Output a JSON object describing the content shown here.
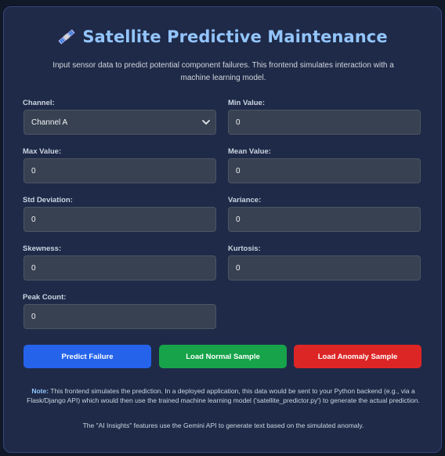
{
  "header": {
    "title": "Satellite Predictive Maintenance",
    "icon": "satellite-icon",
    "intro": "Input sensor data to predict potential component failures. This frontend simulates interaction with a machine learning model."
  },
  "form": {
    "channel": {
      "label": "Channel:",
      "value": "Channel A"
    },
    "min_value": {
      "label": "Min Value:",
      "value": "0"
    },
    "max_value": {
      "label": "Max Value:",
      "value": "0"
    },
    "mean_value": {
      "label": "Mean Value:",
      "value": "0"
    },
    "std_deviation": {
      "label": "Std Deviation:",
      "value": "0"
    },
    "variance": {
      "label": "Variance:",
      "value": "0"
    },
    "skewness": {
      "label": "Skewness:",
      "value": "0"
    },
    "kurtosis": {
      "label": "Kurtosis:",
      "value": "0"
    },
    "peak_count": {
      "label": "Peak Count:",
      "value": "0"
    }
  },
  "buttons": {
    "predict": "Predict Failure",
    "load_normal": "Load Normal Sample",
    "load_anomaly": "Load Anomaly Sample"
  },
  "footer": {
    "note_label": "Note:",
    "note_text": " This frontend simulates the prediction. In a deployed application, this data would be sent to your Python backend (e.g., via a Flask/Django API) which would then use the trained machine learning model ('satellite_predictor.py') to generate the actual prediction.",
    "ai_note": "The \"AI Insights\" features use the Gemini API to generate text based on the simulated anomaly."
  },
  "colors": {
    "background": "#111827",
    "card": "#1f2a48",
    "title": "#93c5fd",
    "predict_button": "#2563eb",
    "normal_button": "#16a34a",
    "anomaly_button": "#dc2626"
  }
}
